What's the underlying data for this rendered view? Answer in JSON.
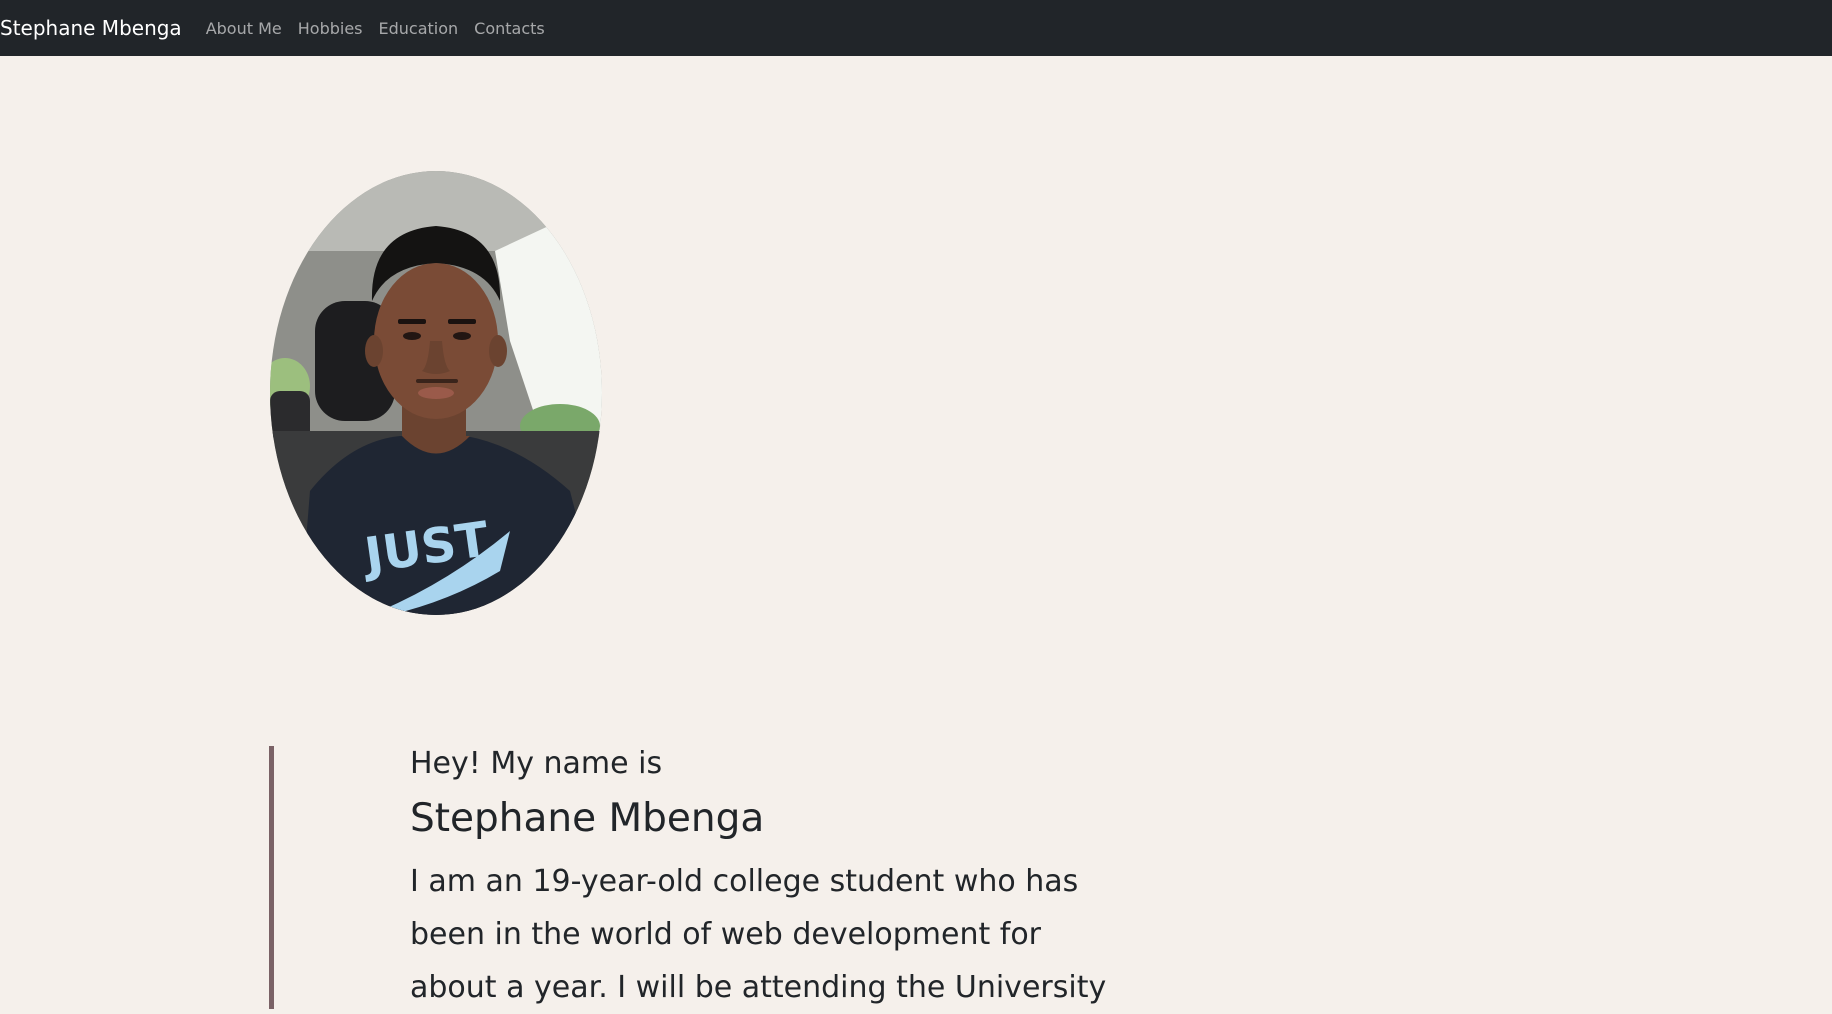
{
  "navbar": {
    "brand": "Stephane Mbenga",
    "links": [
      "About Me",
      "Hobbies",
      "Education",
      "Contacts"
    ]
  },
  "profile": {
    "photo_alt": "Portrait of Stephane Mbenga in a car wearing a black JUST DO IT t-shirt"
  },
  "intro": {
    "greeting": "Hey! My name is",
    "name": "Stephane Mbenga",
    "bio": "I am an 19-year-old college student who has been in the world of web development for about a year. I will be attending the University"
  },
  "colors": {
    "navbar_bg": "#212529",
    "page_bg": "#f5f0eb",
    "accent_border": "#7a6266",
    "text": "#212529"
  }
}
